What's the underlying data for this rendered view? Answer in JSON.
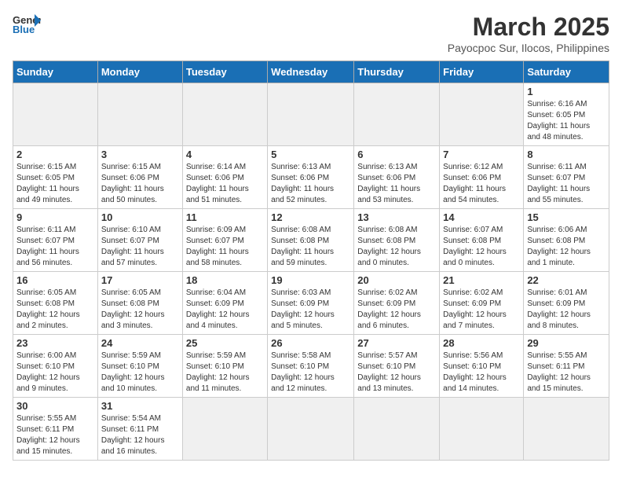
{
  "header": {
    "logo_general": "General",
    "logo_blue": "Blue",
    "month_year": "March 2025",
    "location": "Payocpoc Sur, Ilocos, Philippines"
  },
  "weekdays": [
    "Sunday",
    "Monday",
    "Tuesday",
    "Wednesday",
    "Thursday",
    "Friday",
    "Saturday"
  ],
  "days": [
    {
      "num": "",
      "info": "",
      "empty": true
    },
    {
      "num": "",
      "info": "",
      "empty": true
    },
    {
      "num": "",
      "info": "",
      "empty": true
    },
    {
      "num": "",
      "info": "",
      "empty": true
    },
    {
      "num": "",
      "info": "",
      "empty": true
    },
    {
      "num": "",
      "info": "",
      "empty": true
    },
    {
      "num": "1",
      "info": "Sunrise: 6:16 AM\nSunset: 6:05 PM\nDaylight: 11 hours\nand 48 minutes."
    },
    {
      "num": "2",
      "info": "Sunrise: 6:15 AM\nSunset: 6:05 PM\nDaylight: 11 hours\nand 49 minutes."
    },
    {
      "num": "3",
      "info": "Sunrise: 6:15 AM\nSunset: 6:06 PM\nDaylight: 11 hours\nand 50 minutes."
    },
    {
      "num": "4",
      "info": "Sunrise: 6:14 AM\nSunset: 6:06 PM\nDaylight: 11 hours\nand 51 minutes."
    },
    {
      "num": "5",
      "info": "Sunrise: 6:13 AM\nSunset: 6:06 PM\nDaylight: 11 hours\nand 52 minutes."
    },
    {
      "num": "6",
      "info": "Sunrise: 6:13 AM\nSunset: 6:06 PM\nDaylight: 11 hours\nand 53 minutes."
    },
    {
      "num": "7",
      "info": "Sunrise: 6:12 AM\nSunset: 6:06 PM\nDaylight: 11 hours\nand 54 minutes."
    },
    {
      "num": "8",
      "info": "Sunrise: 6:11 AM\nSunset: 6:07 PM\nDaylight: 11 hours\nand 55 minutes."
    },
    {
      "num": "9",
      "info": "Sunrise: 6:11 AM\nSunset: 6:07 PM\nDaylight: 11 hours\nand 56 minutes."
    },
    {
      "num": "10",
      "info": "Sunrise: 6:10 AM\nSunset: 6:07 PM\nDaylight: 11 hours\nand 57 minutes."
    },
    {
      "num": "11",
      "info": "Sunrise: 6:09 AM\nSunset: 6:07 PM\nDaylight: 11 hours\nand 58 minutes."
    },
    {
      "num": "12",
      "info": "Sunrise: 6:08 AM\nSunset: 6:08 PM\nDaylight: 11 hours\nand 59 minutes."
    },
    {
      "num": "13",
      "info": "Sunrise: 6:08 AM\nSunset: 6:08 PM\nDaylight: 12 hours\nand 0 minutes."
    },
    {
      "num": "14",
      "info": "Sunrise: 6:07 AM\nSunset: 6:08 PM\nDaylight: 12 hours\nand 0 minutes."
    },
    {
      "num": "15",
      "info": "Sunrise: 6:06 AM\nSunset: 6:08 PM\nDaylight: 12 hours\nand 1 minute."
    },
    {
      "num": "16",
      "info": "Sunrise: 6:05 AM\nSunset: 6:08 PM\nDaylight: 12 hours\nand 2 minutes."
    },
    {
      "num": "17",
      "info": "Sunrise: 6:05 AM\nSunset: 6:08 PM\nDaylight: 12 hours\nand 3 minutes."
    },
    {
      "num": "18",
      "info": "Sunrise: 6:04 AM\nSunset: 6:09 PM\nDaylight: 12 hours\nand 4 minutes."
    },
    {
      "num": "19",
      "info": "Sunrise: 6:03 AM\nSunset: 6:09 PM\nDaylight: 12 hours\nand 5 minutes."
    },
    {
      "num": "20",
      "info": "Sunrise: 6:02 AM\nSunset: 6:09 PM\nDaylight: 12 hours\nand 6 minutes."
    },
    {
      "num": "21",
      "info": "Sunrise: 6:02 AM\nSunset: 6:09 PM\nDaylight: 12 hours\nand 7 minutes."
    },
    {
      "num": "22",
      "info": "Sunrise: 6:01 AM\nSunset: 6:09 PM\nDaylight: 12 hours\nand 8 minutes."
    },
    {
      "num": "23",
      "info": "Sunrise: 6:00 AM\nSunset: 6:10 PM\nDaylight: 12 hours\nand 9 minutes."
    },
    {
      "num": "24",
      "info": "Sunrise: 5:59 AM\nSunset: 6:10 PM\nDaylight: 12 hours\nand 10 minutes."
    },
    {
      "num": "25",
      "info": "Sunrise: 5:59 AM\nSunset: 6:10 PM\nDaylight: 12 hours\nand 11 minutes."
    },
    {
      "num": "26",
      "info": "Sunrise: 5:58 AM\nSunset: 6:10 PM\nDaylight: 12 hours\nand 12 minutes."
    },
    {
      "num": "27",
      "info": "Sunrise: 5:57 AM\nSunset: 6:10 PM\nDaylight: 12 hours\nand 13 minutes."
    },
    {
      "num": "28",
      "info": "Sunrise: 5:56 AM\nSunset: 6:10 PM\nDaylight: 12 hours\nand 14 minutes."
    },
    {
      "num": "29",
      "info": "Sunrise: 5:55 AM\nSunset: 6:11 PM\nDaylight: 12 hours\nand 15 minutes."
    },
    {
      "num": "30",
      "info": "Sunrise: 5:55 AM\nSunset: 6:11 PM\nDaylight: 12 hours\nand 15 minutes."
    },
    {
      "num": "31",
      "info": "Sunrise: 5:54 AM\nSunset: 6:11 PM\nDaylight: 12 hours\nand 16 minutes."
    },
    {
      "num": "",
      "info": "",
      "empty": true
    },
    {
      "num": "",
      "info": "",
      "empty": true
    },
    {
      "num": "",
      "info": "",
      "empty": true
    },
    {
      "num": "",
      "info": "",
      "empty": true
    },
    {
      "num": "",
      "info": "",
      "empty": true
    }
  ]
}
